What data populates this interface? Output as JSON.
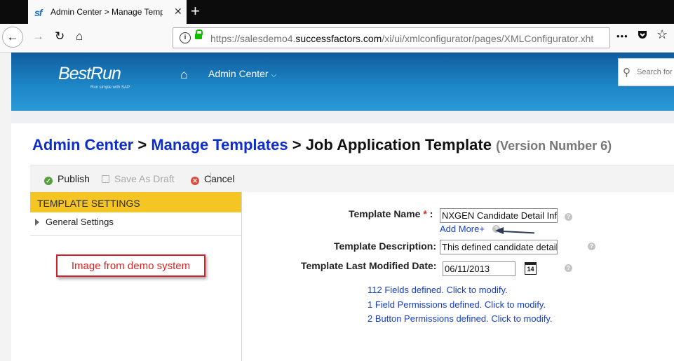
{
  "browser": {
    "tab_icon": "sf",
    "tab_title": "Admin Center > Manage Temp",
    "tab_close": "✕",
    "new_tab": "+",
    "url_prefix": "https://salesdemo4.",
    "url_domain": "successfactors.com",
    "url_path": "/xi/ui/xmlconfigurator/pages/XMLConfigurator.xht",
    "more": "•••"
  },
  "header": {
    "brand": "BestRun",
    "brand_tagline": "Run simple with SAP",
    "menu_label": "Admin Center",
    "search_placeholder": "Search for"
  },
  "breadcrumb": {
    "item1": "Admin Center",
    "item2": "Manage Templates",
    "separator": ">",
    "current": "Job Application Template",
    "version": "(Version Number 6)"
  },
  "toolbar": {
    "publish": "Publish",
    "save_draft": "Save As Draft",
    "cancel": "Cancel"
  },
  "sidebar": {
    "header": "TEMPLATE SETTINGS",
    "items": [
      {
        "label": "General Settings"
      }
    ],
    "annotation": "Image from demo system"
  },
  "form": {
    "template_name_label": "Template Name",
    "required_mark": "*",
    "colon": ":",
    "template_name_value": "NXGEN Candidate Detail Info",
    "add_more": "Add More+",
    "description_label": "Template Description:",
    "description_value": "This defined candidate detail",
    "modified_label": "Template Last Modified Date:",
    "modified_value": "06/11/2013",
    "calendar_day": "14",
    "help_mark": "?"
  },
  "links": {
    "fields": "112 Fields defined. Click to modify.",
    "field_permissions": "1 Field Permissions defined. Click to modify.",
    "button_permissions": "2 Button Permissions defined. Click to modify."
  },
  "colors": {
    "brand_blue": "#1c85c6",
    "breadcrumb_link": "#0d2ec8",
    "sidebar_header": "#f5c523",
    "annotation_red": "#d01f28"
  }
}
